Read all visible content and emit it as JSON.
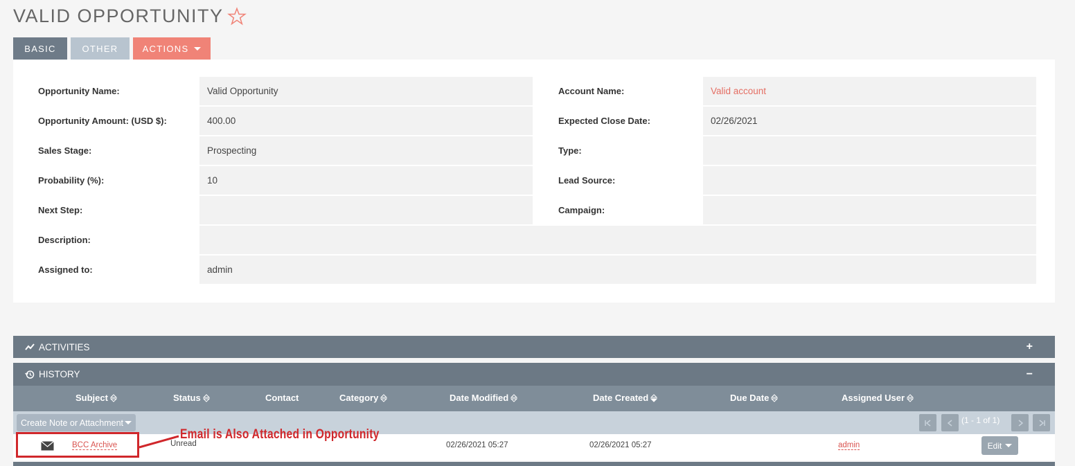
{
  "title": "VALID OPPORTUNITY",
  "tabs": {
    "basic": "BASIC",
    "other": "OTHER",
    "actions": "ACTIONS"
  },
  "fields": {
    "opportunity_name": {
      "label": "Opportunity Name:",
      "value": "Valid Opportunity"
    },
    "amount": {
      "label": "Opportunity Amount: (USD $):",
      "value": "400.00"
    },
    "sales_stage": {
      "label": "Sales Stage:",
      "value": "Prospecting"
    },
    "probability": {
      "label": "Probability (%):",
      "value": "10"
    },
    "next_step": {
      "label": "Next Step:",
      "value": ""
    },
    "description": {
      "label": "Description:",
      "value": ""
    },
    "assigned_to": {
      "label": "Assigned to:",
      "value": "admin"
    },
    "account_name": {
      "label": "Account Name:",
      "value": "Valid account"
    },
    "expected_close": {
      "label": "Expected Close Date:",
      "value": "02/26/2021"
    },
    "type": {
      "label": "Type:",
      "value": ""
    },
    "lead_source": {
      "label": "Lead Source:",
      "value": ""
    },
    "campaign": {
      "label": "Campaign:",
      "value": ""
    }
  },
  "subpanels": {
    "activities": {
      "title": "ACTIVITIES",
      "toggle": "+"
    },
    "history": {
      "title": "HISTORY",
      "toggle": "−"
    }
  },
  "history_columns": [
    "Subject",
    "Status",
    "Contact",
    "Category",
    "Date Modified",
    "Date Created",
    "Due Date",
    "Assigned User"
  ],
  "toolbar": {
    "create_label": "Create Note or Attachment",
    "pager_text": "(1 - 1 of 1)"
  },
  "history_rows": [
    {
      "subject": "BCC Archive",
      "status": "Unread",
      "contact": "",
      "category": "",
      "date_modified": "02/26/2021 05:27",
      "date_created": "02/26/2021 05:27",
      "due_date": "",
      "assigned_user": "admin",
      "edit_label": "Edit"
    }
  ],
  "annotation": "Email is Also Attached in Opportunity",
  "colors": {
    "accent": "#f08377",
    "header": "#6c7985",
    "link": "#e46e63",
    "annotation": "#d0272b"
  },
  "icons": [
    "star-icon",
    "activities-icon",
    "history-icon",
    "sort-icon",
    "envelope-icon",
    "caret-down-icon",
    "pager-first-icon",
    "pager-prev-icon",
    "pager-next-icon",
    "pager-last-icon"
  ]
}
